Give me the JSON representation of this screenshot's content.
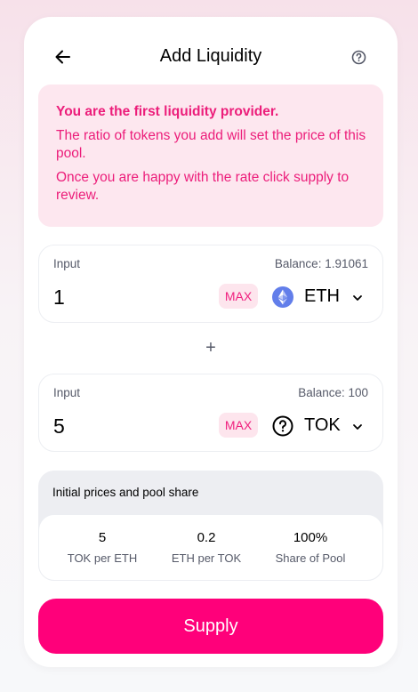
{
  "header": {
    "title": "Add Liquidity",
    "back_icon": "arrow-left-icon",
    "help_icon": "question-circle-icon"
  },
  "notice": {
    "title": "You are the first liquidity provider.",
    "line1": "The ratio of tokens you add will set the price of this pool.",
    "line2": "Once you are happy with the rate click supply to review."
  },
  "input_a": {
    "label": "Input",
    "balance": "Balance: 1.91061",
    "value": "1",
    "max_label": "MAX",
    "token_symbol": "ETH",
    "token_icon": "ethereum-icon"
  },
  "plus_sign": "+",
  "input_b": {
    "label": "Input",
    "balance": "Balance: 100",
    "value": "5",
    "max_label": "MAX",
    "token_symbol": "TOK",
    "token_icon": "question-circle-icon"
  },
  "prices": {
    "title": "Initial prices and pool share",
    "items": [
      {
        "value": "5",
        "label": "TOK per ETH"
      },
      {
        "value": "0.2",
        "label": "ETH per TOK"
      },
      {
        "value": "100%",
        "label": "Share of Pool"
      }
    ]
  },
  "supply_button": "Supply",
  "colors": {
    "accent": "#ff007a",
    "notice_bg": "#fde7ef",
    "notice_text": "#ec1d7a",
    "max_bg": "#fde5ed"
  }
}
